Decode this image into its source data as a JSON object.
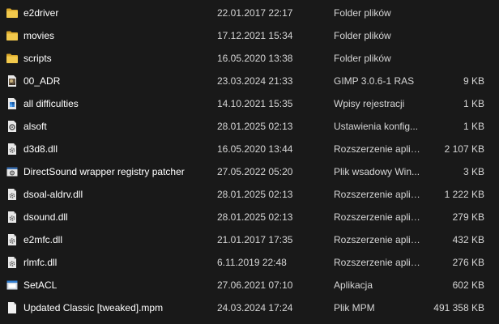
{
  "colors": {
    "background": "#191919",
    "folder": "#f2c94c",
    "text": "#ffffff",
    "secondary_text": "#d6d6d6"
  },
  "files": [
    {
      "name": "e2driver",
      "date": "22.01.2017 22:17",
      "type": "Folder plików",
      "size": "",
      "icon": "folder-icon"
    },
    {
      "name": "movies",
      "date": "17.12.2021 15:34",
      "type": "Folder plików",
      "size": "",
      "icon": "folder-icon"
    },
    {
      "name": "scripts",
      "date": "16.05.2020 13:38",
      "type": "Folder plików",
      "size": "",
      "icon": "folder-icon"
    },
    {
      "name": "00_ADR",
      "date": "23.03.2024 21:33",
      "type": "GIMP 3.0.6-1 RAS",
      "size": "9 KB",
      "icon": "gimp-image-icon"
    },
    {
      "name": "all difficulties",
      "date": "14.10.2021 15:35",
      "type": "Wpisy rejestracji",
      "size": "1 KB",
      "icon": "registry-file-icon"
    },
    {
      "name": "alsoft",
      "date": "28.01.2025 02:13",
      "type": "Ustawienia konfig...",
      "size": "1 KB",
      "icon": "config-file-icon"
    },
    {
      "name": "d3d8.dll",
      "date": "16.05.2020 13:44",
      "type": "Rozszerzenie aplik...",
      "size": "2 107 KB",
      "icon": "dll-file-icon"
    },
    {
      "name": "DirectSound wrapper registry patcher",
      "date": "27.05.2022 05:20",
      "type": "Plik wsadowy Win...",
      "size": "3 KB",
      "icon": "batch-file-icon"
    },
    {
      "name": "dsoal-aldrv.dll",
      "date": "28.01.2025 02:13",
      "type": "Rozszerzenie aplik...",
      "size": "1 222 KB",
      "icon": "dll-file-icon"
    },
    {
      "name": "dsound.dll",
      "date": "28.01.2025 02:13",
      "type": "Rozszerzenie aplik...",
      "size": "279 KB",
      "icon": "dll-file-icon"
    },
    {
      "name": "e2mfc.dll",
      "date": "21.01.2017 17:35",
      "type": "Rozszerzenie aplik...",
      "size": "432 KB",
      "icon": "dll-file-icon"
    },
    {
      "name": "rlmfc.dll",
      "date": "6.11.2019 22:48",
      "type": "Rozszerzenie aplik...",
      "size": "276 KB",
      "icon": "dll-file-icon"
    },
    {
      "name": "SetACL",
      "date": "27.06.2021 07:10",
      "type": "Aplikacja",
      "size": "602 KB",
      "icon": "application-icon"
    },
    {
      "name": "Updated Classic [tweaked].mpm",
      "date": "24.03.2024 17:24",
      "type": "Plik MPM",
      "size": "491 358 KB",
      "icon": "generic-file-icon"
    }
  ]
}
